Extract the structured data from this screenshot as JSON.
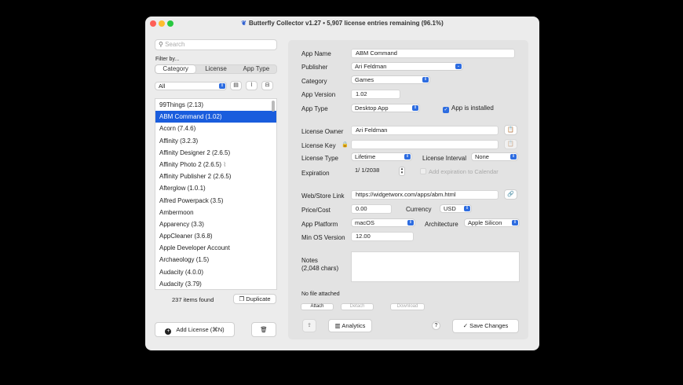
{
  "window": {
    "title": "Butterfly Collector v1.27 • 5,907 license entries remaining (96.1%)",
    "colors": {
      "close": "#fe5f57",
      "minimize": "#febc2e",
      "zoom": "#28c840",
      "accent": "#1a5ddd"
    }
  },
  "sidebar": {
    "search_placeholder": "Search",
    "filter_label": "Filter by...",
    "filter_tabs": [
      "Category",
      "License",
      "App Type"
    ],
    "filter_value": "All",
    "items": [
      "99Things (2.13)",
      "ABM Command (1.02)",
      "Acorn (7.4.6)",
      "Affinity (3.2.3)",
      "Affinity Designer 2 (2.6.5)",
      "Affinity Photo 2 (2.6.5)",
      "Affinity Publisher 2 (2.6.5)",
      "Afterglow (1.0.1)",
      "Alfred Powerpack (3.5)",
      "Ambermoon",
      "Apparency (3.3)",
      "AppCleaner (3.6.8)",
      "Apple Developer Account",
      "Archaeology (1.5)",
      "Audacity (4.0.0)",
      "Audacity (3.79)"
    ],
    "count_text": "237 items found",
    "duplicate_label": "Duplicate",
    "add_license_label": "Add License (⌘N)"
  },
  "form": {
    "app_name_label": "App Name",
    "app_name": "ABM Command",
    "publisher_label": "Publisher",
    "publisher": "Ari Feldman",
    "category_label": "Category",
    "category": "Games",
    "app_version_label": "App Version",
    "app_version": "1.02",
    "app_type_label": "App Type",
    "app_type": "Desktop App",
    "installed_label": "App is installed",
    "license_owner_label": "License Owner",
    "license_owner": "Ari Feldman",
    "license_key_label": "License Key",
    "license_key": "",
    "license_type_label": "License Type",
    "license_type": "Lifetime",
    "license_interval_label": "License Interval",
    "license_interval": "None",
    "expiration_label": "Expiration",
    "expiration": "1/  1/2038",
    "add_calendar_label": "Add expiration to Calendar",
    "web_link_label": "Web/Store Link",
    "web_link": "https://widgetworx.com/apps/abm.html",
    "price_label": "Price/Cost",
    "price": "0.00",
    "currency_label": "Currency",
    "currency": "USD",
    "platform_label": "App Platform",
    "platform": "macOS",
    "architecture_label": "Architecture",
    "architecture": "Apple Silicon",
    "min_os_label": "Min OS Version",
    "min_os": "12.00",
    "notes_label": "Notes",
    "notes_chars": "(2,048 chars)",
    "file_status": "No file attached",
    "attach_label": "Attach",
    "detach_label": "Detach",
    "download_label": "Download",
    "analytics_label": "Analytics",
    "help_label": "?",
    "save_label": "Save Changes"
  }
}
